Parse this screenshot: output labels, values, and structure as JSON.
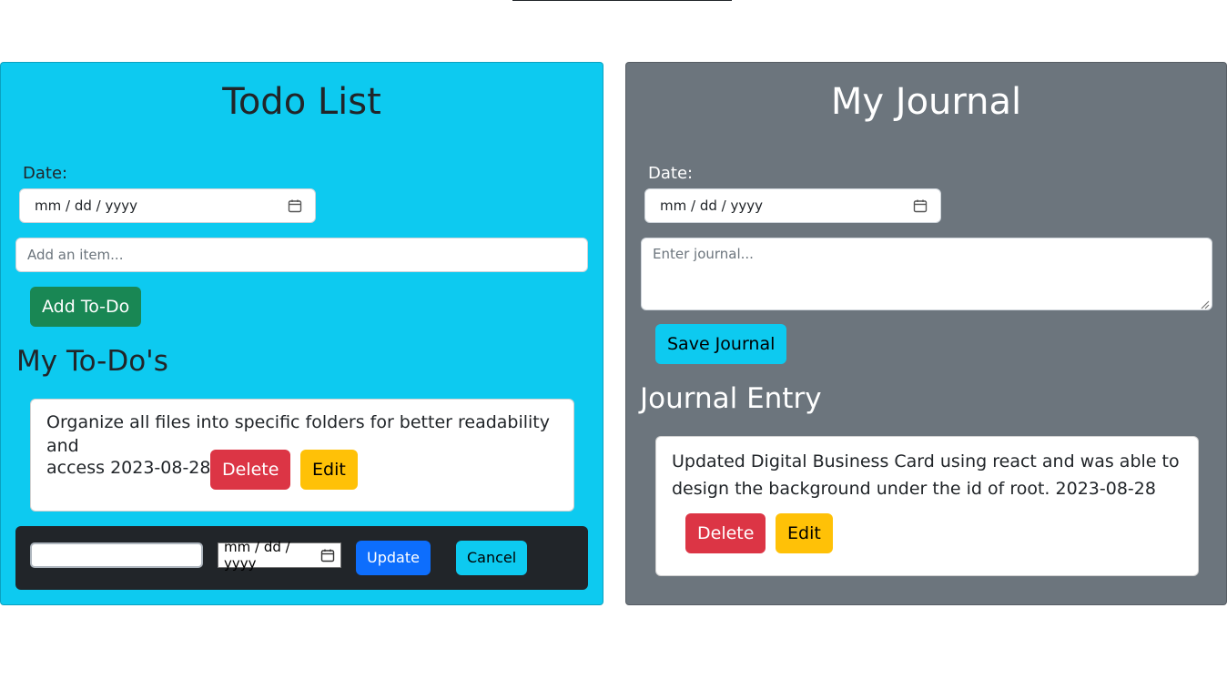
{
  "todo": {
    "title": "Todo List",
    "date_label": "Date:",
    "date_placeholder": "mm / dd / yyyy",
    "item_placeholder": "Add an item...",
    "add_button": "Add To-Do",
    "list_heading": "My To-Do's",
    "items": [
      {
        "text_line1": "Organize all files into specific folders for better readability and",
        "text_line2": "access 2023-08-28",
        "delete_label": "Delete",
        "edit_label": "Edit"
      }
    ],
    "edit_bar": {
      "text_value": "",
      "date_placeholder": "mm / dd / yyyy",
      "update_label": "Update",
      "cancel_label": "Cancel"
    }
  },
  "journal": {
    "title": "My Journal",
    "date_label": "Date:",
    "date_placeholder": "mm / dd / yyyy",
    "entry_placeholder": "Enter journal...",
    "save_button": "Save Journal",
    "entry_heading": "Journal Entry",
    "entries": [
      {
        "text_line1": "Updated Digital Business Card using react and was able to",
        "text_line2": "design the background under the id of root. 2023-08-28",
        "delete_label": "Delete",
        "edit_label": "Edit"
      }
    ]
  },
  "colors": {
    "todo_panel": "#0dcaf0",
    "journal_panel": "#6c757d",
    "success": "#198754",
    "danger": "#dc3545",
    "warning": "#ffc107",
    "primary": "#0d6efd",
    "dark": "#212529"
  },
  "icons": {
    "calendar": "calendar-icon",
    "resize": "resize-grip-icon"
  }
}
